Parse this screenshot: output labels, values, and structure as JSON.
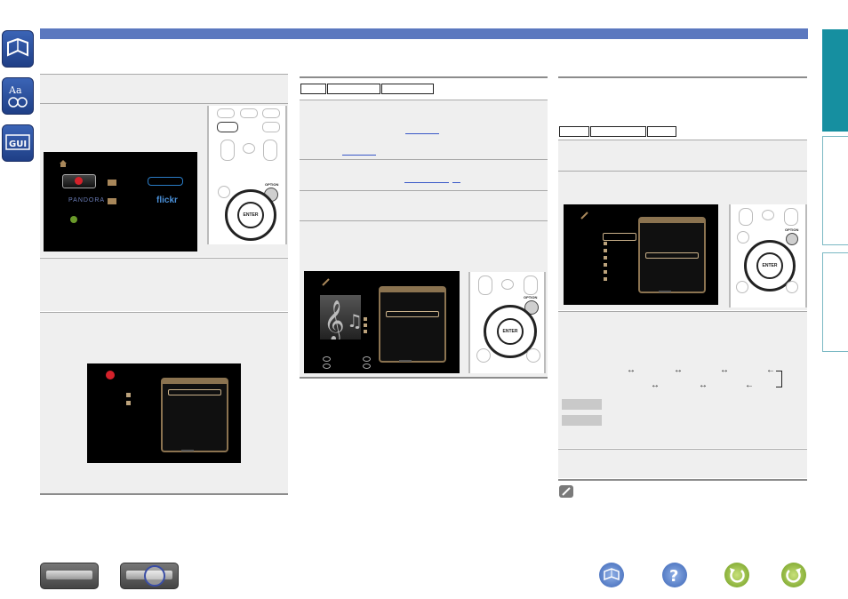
{
  "menu_screens": {
    "network_menu": {
      "services": [
        {
          "label": "PANDORA"
        },
        {
          "label": "flickr"
        }
      ]
    },
    "playback_option_menu": {
      "center_button": "ENTER"
    }
  },
  "remote": {
    "option_label": "OPTION",
    "enter_label": "ENTER"
  },
  "left_tabs": [
    "book-icon",
    "glossary-icon",
    "gui-icon"
  ],
  "footer_icons": [
    "front-panel-icon",
    "rear-panel-icon",
    "contents-icon",
    "help-icon",
    "back-icon",
    "forward-icon"
  ],
  "colors": {
    "accent_blue": "#5b78bf",
    "teal_tab": "#168fa0"
  }
}
